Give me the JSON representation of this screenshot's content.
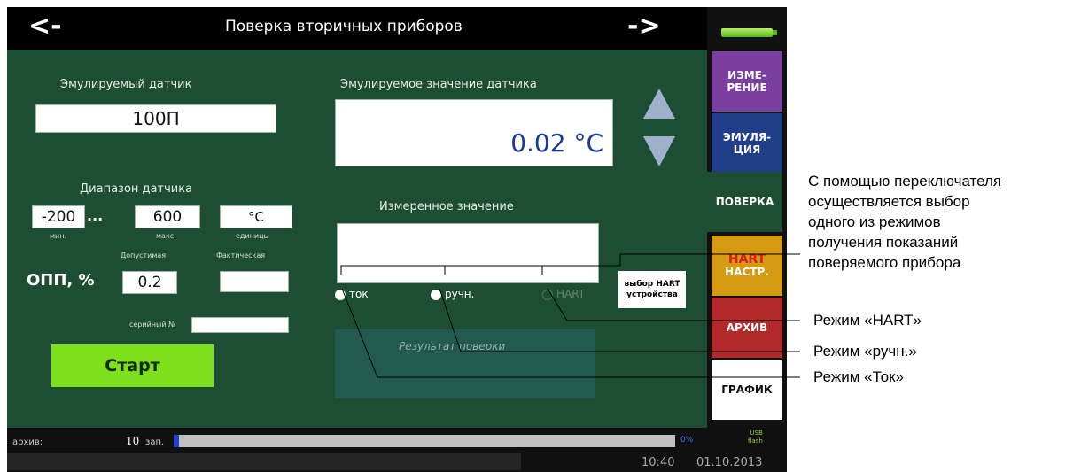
{
  "topbar": {
    "back": "<-",
    "forward": "->",
    "title": "Поверка вторичных приборов"
  },
  "sensor": {
    "heading": "Эмулируемый датчик",
    "value": "100П"
  },
  "range": {
    "heading": "Диапазон датчика",
    "min": "-200",
    "dots": "...",
    "max": "600",
    "units": "°C",
    "min_caption": "мин.",
    "max_caption": "макс.",
    "units_caption": "единицы"
  },
  "opp": {
    "label": "ОПП, %",
    "allowed_caption": "Допустимая",
    "actual_caption": "Фактическая",
    "allowed": "0.2",
    "actual": ""
  },
  "serial": {
    "label": "серийный №",
    "value": ""
  },
  "start_label": "Старт",
  "emulated": {
    "heading": "Эмулируемое значение датчика",
    "value": "0.02 °C"
  },
  "measured": {
    "heading": "Измеренное значение",
    "value": ""
  },
  "modes": [
    {
      "label": "ток"
    },
    {
      "label": "ручн."
    },
    {
      "label": "HART"
    }
  ],
  "hart_select": {
    "line1": "выбор HART",
    "line2": "устройства"
  },
  "result": {
    "text": "Результат поверки"
  },
  "tabs": [
    {
      "label": "ИЗМЕ-\nРЕНИЕ",
      "color": "#7b3fa0"
    },
    {
      "label": "ЭМУЛЯ-\nЦИЯ",
      "color": "#203e8a"
    },
    {
      "label": "ПОВЕРКА",
      "color": "#1d4e33"
    },
    {
      "label_top": "HART",
      "label_bottom": "НАСТР.",
      "color": "#d49a12"
    },
    {
      "label": "АРХИВ",
      "color": "#b3282a"
    },
    {
      "label": "ГРАФИК",
      "color": "#ffffff"
    }
  ],
  "status": {
    "archive_label": "архив:",
    "archive_count": "10",
    "archive_unit": "зап.",
    "progress": 0.01,
    "progress_text": "0%",
    "usb_line1": "USB",
    "usb_line2": "flash",
    "time": "10:40",
    "date": "01.10.2013"
  },
  "annotations": {
    "switch_note": [
      "С помощью переключателя",
      "осуществляется выбор",
      "одного из режимов",
      "получения показаний",
      "поверяемого прибора"
    ],
    "mode_hart": "Режим «HART»",
    "mode_manual": "Режим «ручн.»",
    "mode_current": "Режим «Ток»"
  },
  "colors": {
    "panel": "#1d4e33",
    "start_button": "#7de01a",
    "result_panel": "#235a50",
    "arrow": "#9fb0cc"
  }
}
